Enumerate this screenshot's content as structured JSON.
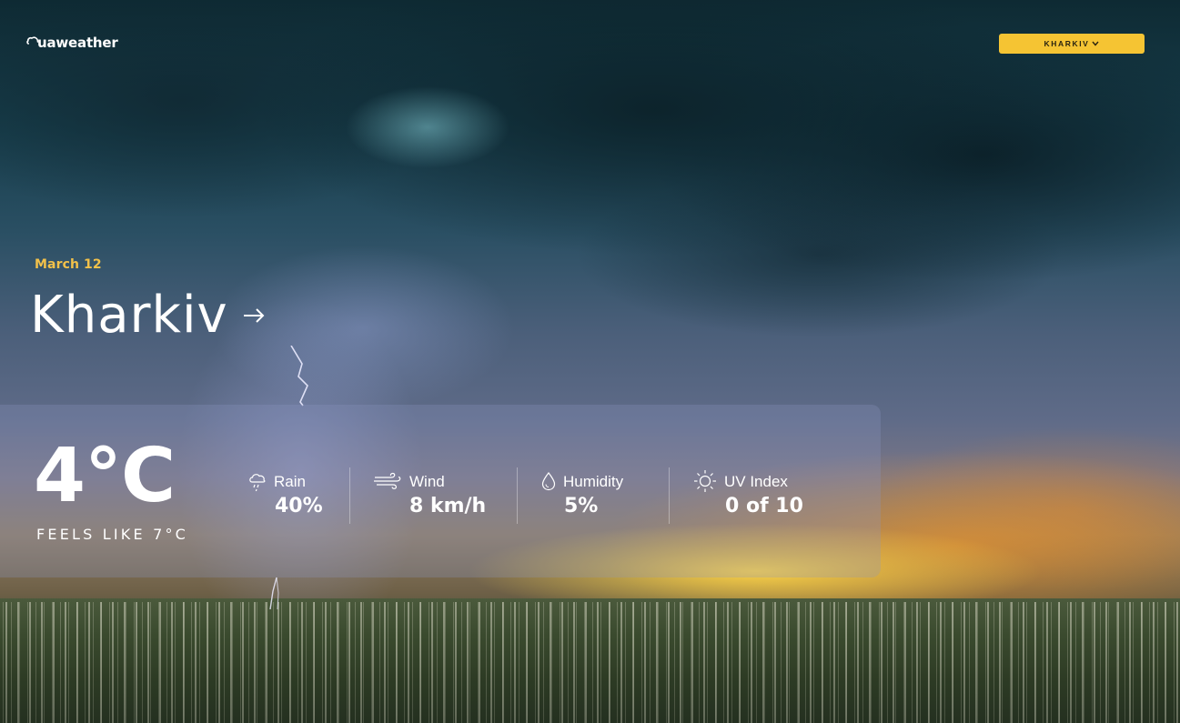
{
  "header": {
    "logo_text": "uaweather",
    "city_selector_label": "KHARKIV"
  },
  "hero": {
    "date": "March 12",
    "city": "Kharkiv"
  },
  "current": {
    "temperature": "4°C",
    "feels_like": "FEELS LIKE 7°C"
  },
  "stats": {
    "rain": {
      "label": "Rain",
      "value": "40%",
      "icon": "rain-cloud-icon"
    },
    "wind": {
      "label": "Wind",
      "value": "8 km/h",
      "icon": "wind-icon"
    },
    "humidity": {
      "label": "Humidity",
      "value": "5%",
      "icon": "droplet-icon"
    },
    "uv": {
      "label": "UV Index",
      "value": "0 of 10",
      "icon": "sun-icon"
    }
  },
  "colors": {
    "accent_yellow": "#f5c433",
    "date_gold": "#f2c14a",
    "text": "#ffffff"
  }
}
